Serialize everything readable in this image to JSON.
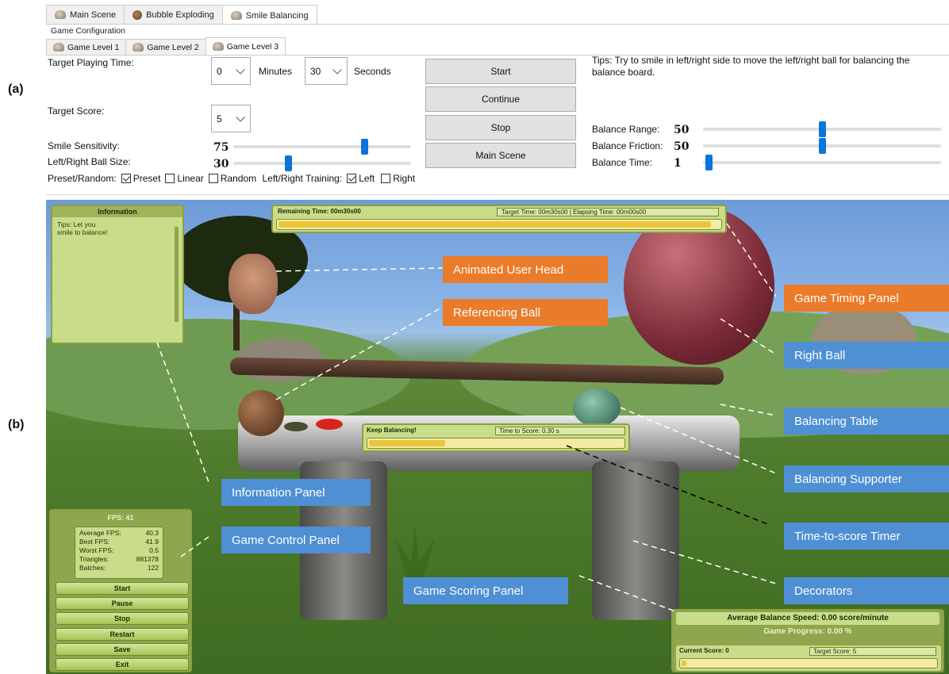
{
  "panel_labels": {
    "a": "(a)",
    "b": "(b)"
  },
  "config": {
    "main_tabs": [
      {
        "label": "Main Scene",
        "icon": "head-icon"
      },
      {
        "label": "Bubble Exploding",
        "icon": "brown-ball-icon"
      },
      {
        "label": "Smile Balancing",
        "icon": "head-icon",
        "active": true
      }
    ],
    "group_title": "Game Configuration",
    "sub_tabs": [
      {
        "label": "Game Level 1"
      },
      {
        "label": "Game Level 2"
      },
      {
        "label": "Game Level 3",
        "active": true
      }
    ],
    "target_playing_time": {
      "label": "Target Playing Time:",
      "minutes_value": "0",
      "minutes_unit": "Minutes",
      "seconds_value": "30",
      "seconds_unit": "Seconds"
    },
    "target_score": {
      "label": "Target Score:",
      "value": "5"
    },
    "smile_sensitivity": {
      "label": "Smile Sensitivity:",
      "value": "75",
      "level": 0.75
    },
    "ball_size": {
      "label": "Left/Right Ball Size:",
      "value": "30",
      "level": 0.3
    },
    "preset_random": {
      "label": "Preset/Random:",
      "options": [
        {
          "label": "Preset",
          "checked": true
        },
        {
          "label": "Linear",
          "checked": false
        },
        {
          "label": "Random",
          "checked": false
        }
      ]
    },
    "training": {
      "label": "Left/Right Training:",
      "options": [
        {
          "label": "Left",
          "checked": true
        },
        {
          "label": "Right",
          "checked": false
        }
      ]
    },
    "buttons": {
      "start": "Start",
      "continue": "Continue",
      "stop": "Stop",
      "main_scene": "Main Scene"
    },
    "tips": "Tips: Try to smile in left/right side to move the left/right ball for balancing the balance board.",
    "balance_range": {
      "label": "Balance Range:",
      "value": "50",
      "level": 0.5
    },
    "balance_friction": {
      "label": "Balance Friction:",
      "value": "50",
      "level": 0.5
    },
    "balance_time": {
      "label": "Balance Time:",
      "value": "1",
      "level": 0.01
    }
  },
  "scene": {
    "information": {
      "title": "Information",
      "text": "Tips: Let you smile to balance!"
    },
    "timing": {
      "remaining": "Remaining Time: 00m30s00",
      "target_elapsed": "Target Time: 00m30s00 | Elapsing Time: 00m00s00",
      "progress": 0.98
    },
    "keep_balancing": {
      "label": "Keep Balancing!",
      "time_to_score": "Time to Score: 0.30 s",
      "progress": 0.3
    },
    "fps_panel": {
      "title": "FPS: 41",
      "stats": [
        {
          "label": "Average FPS:",
          "value": "40.3"
        },
        {
          "label": "Best FPS:",
          "value": "41.9"
        },
        {
          "label": "Worst FPS:",
          "value": "0.5"
        },
        {
          "label": "Triangles:",
          "value": "881378"
        },
        {
          "label": "Batches:",
          "value": "122"
        }
      ],
      "buttons": [
        "Start",
        "Pause",
        "Stop",
        "Restart",
        "Save",
        "Exit"
      ]
    },
    "scoring": {
      "avg_speed": "Average Balance Speed: 0.00 score/minute",
      "progress_text": "Game Progress: 0.00 %",
      "current_score": "Current Score: 0",
      "target_score": "Target Score: 5"
    },
    "annotations": {
      "animated_user_head": "Animated User Head",
      "referencing_ball": "Referencing Ball",
      "game_timing_panel": "Game Timing Panel",
      "right_ball": "Right Ball",
      "balancing_table": "Balancing Table",
      "balancing_supporter": "Balancing Supporter",
      "information_panel": "Information Panel",
      "game_control_panel": "Game Control Panel",
      "time_to_score_timer": "Time-to-score Timer",
      "game_scoring_panel": "Game Scoring Panel",
      "decorators": "Decorators"
    },
    "colors": {
      "orange_label": "#ea7b2a",
      "blue_label": "#4f8fd4",
      "slider_thumb": "#0a74da"
    }
  }
}
